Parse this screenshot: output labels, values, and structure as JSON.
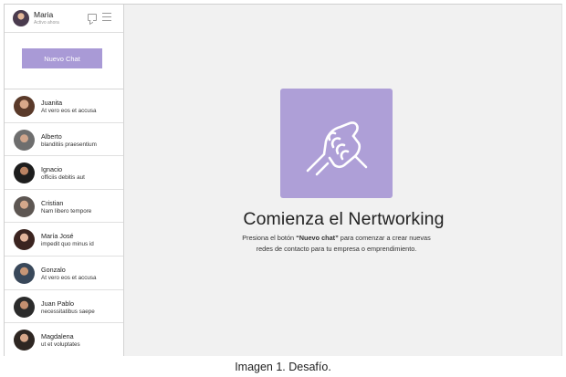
{
  "user": {
    "name": "Maria",
    "status": "Activo ahora"
  },
  "sidebar": {
    "new_chat_label": "Nuevo Chat",
    "contacts": [
      {
        "name": "Juanita",
        "message": "At vero eos et accusa"
      },
      {
        "name": "Alberto",
        "message": "blanditiis praesentium"
      },
      {
        "name": "Ignacio",
        "message": "officiis debitis aut"
      },
      {
        "name": "Cristian",
        "message": "Nam libero tempore"
      },
      {
        "name": "María José",
        "message": " impedit quo minus id"
      },
      {
        "name": "Gonzalo",
        "message": "At vero eos et accusa"
      },
      {
        "name": "Juan Pablo",
        "message": "necessitatibus saepe"
      },
      {
        "name": "Magdalena",
        "message": "ut et voluptates"
      }
    ]
  },
  "main": {
    "title": "Comienza el Nertworking",
    "desc_prefix": "Presiona el botón ",
    "desc_bold": "“Nuevo chat”",
    "desc_suffix": " para comenzar a crear nuevas redes de contacto para tu empresa o emprendimiento."
  },
  "caption": "Imagen 1. Desafío.",
  "colors": {
    "accent": "#a99ad6",
    "hero_box": "#ae9fd7",
    "main_bg": "#f1f1f1"
  },
  "icons": {
    "header": [
      "chat-bubble-icon",
      "menu-icon"
    ],
    "hero": "handshake-icon"
  }
}
